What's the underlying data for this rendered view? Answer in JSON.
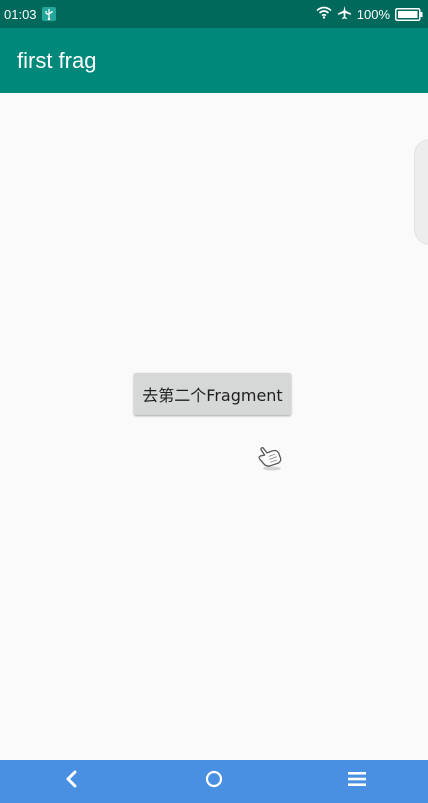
{
  "status_bar": {
    "time": "01:03",
    "battery": "100%",
    "icons": [
      "usb-icon",
      "wifi-icon",
      "airplane-icon",
      "battery-icon"
    ]
  },
  "app_bar": {
    "title": "first frag",
    "color": "#00897b"
  },
  "main": {
    "button_label": "去第二个Fragment"
  },
  "nav_bar": {
    "color": "#4a90e2",
    "icons": [
      "back-icon",
      "home-icon",
      "menu-icon"
    ]
  }
}
